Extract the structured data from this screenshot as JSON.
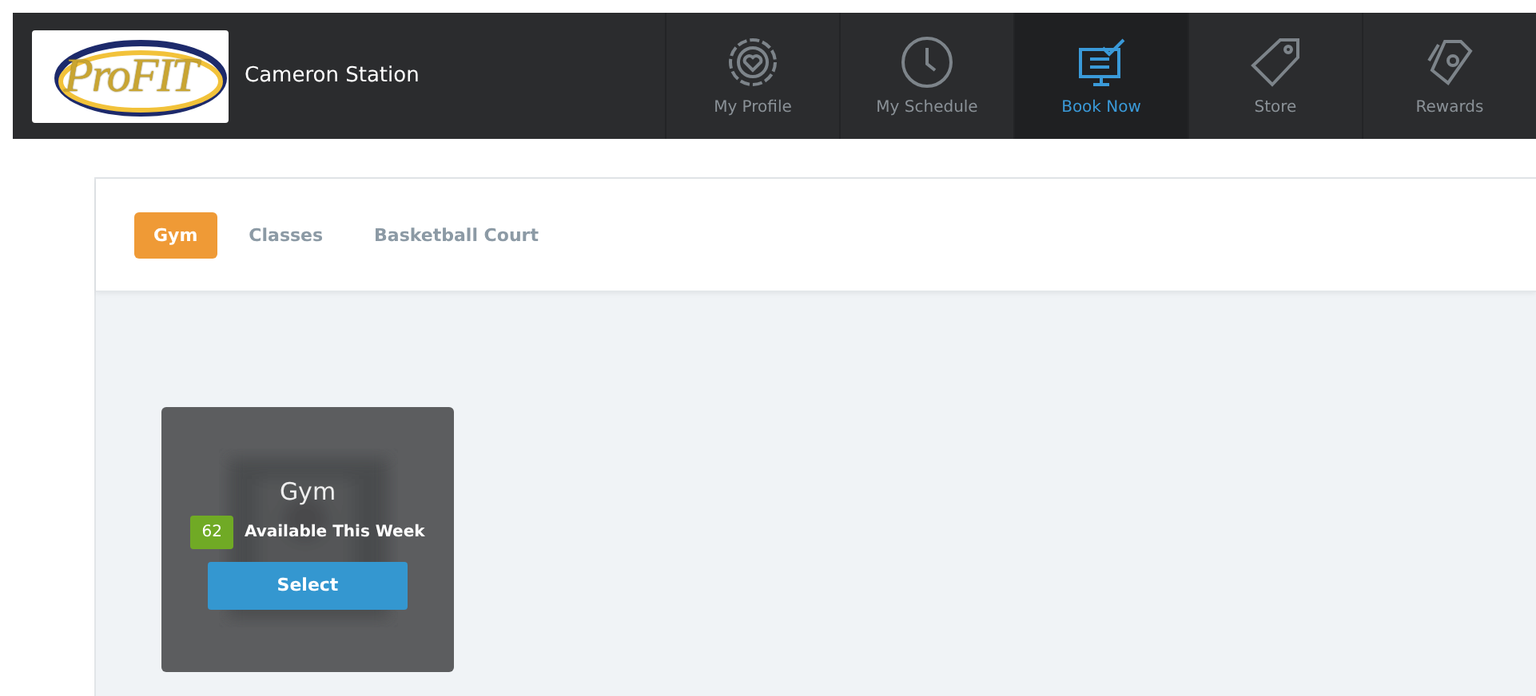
{
  "header": {
    "brand": "ProFIT",
    "location": "Cameron Station",
    "nav": [
      {
        "label": "My Profile",
        "kind": "profile",
        "selected": false
      },
      {
        "label": "My Schedule",
        "kind": "schedule",
        "selected": false
      },
      {
        "label": "Book Now",
        "kind": "book",
        "selected": true
      },
      {
        "label": "Store",
        "kind": "store",
        "selected": false
      },
      {
        "label": "Rewards",
        "kind": "rewards",
        "selected": false
      }
    ]
  },
  "tabs": [
    {
      "label": "Gym",
      "selected": true
    },
    {
      "label": "Classes",
      "selected": false
    },
    {
      "label": "Basketball Court",
      "selected": false
    }
  ],
  "cards": [
    {
      "title": "Gym",
      "count": "62",
      "availability": "Available This Week",
      "button": "Select"
    }
  ]
}
